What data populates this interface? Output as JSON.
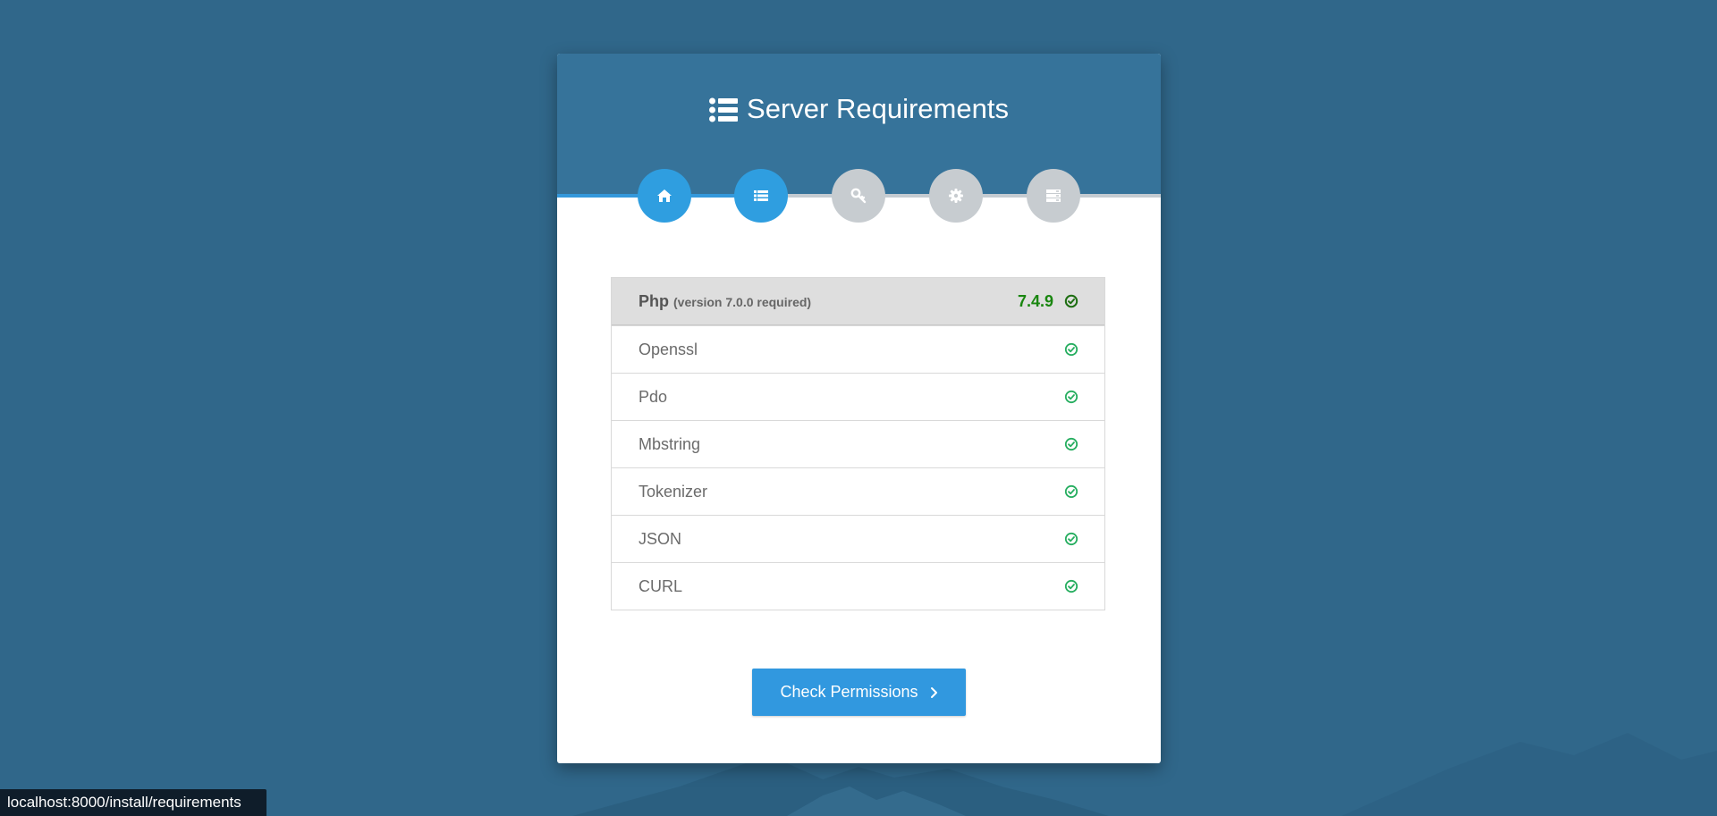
{
  "header": {
    "title": "Server Requirements",
    "title_icon": "list-icon"
  },
  "steps": [
    {
      "name": "home-icon",
      "active": true
    },
    {
      "name": "list-icon",
      "active": true
    },
    {
      "name": "key-icon",
      "active": false
    },
    {
      "name": "gear-icon",
      "active": false
    },
    {
      "name": "server-icon",
      "active": false
    }
  ],
  "php": {
    "label": "Php",
    "note": "(version 7.0.0 required)",
    "version": "7.4.9",
    "status_icon": "check-circle-icon"
  },
  "requirements": [
    {
      "label": "Openssl",
      "status_icon": "check-circle-icon"
    },
    {
      "label": "Pdo",
      "status_icon": "check-circle-icon"
    },
    {
      "label": "Mbstring",
      "status_icon": "check-circle-icon"
    },
    {
      "label": "Tokenizer",
      "status_icon": "check-circle-icon"
    },
    {
      "label": "JSON",
      "status_icon": "check-circle-icon"
    },
    {
      "label": "CURL",
      "status_icon": "check-circle-icon"
    }
  ],
  "button": {
    "label": "Check Permissions",
    "icon": "chevron-right-icon"
  },
  "status_bar": {
    "url": "localhost:8000/install/requirements"
  },
  "colors": {
    "background": "#30678a",
    "header": "#36739a",
    "accent": "#3498db",
    "success": "#19860f",
    "check": "#27ae60",
    "inactive_step": "#c7ccd0"
  }
}
